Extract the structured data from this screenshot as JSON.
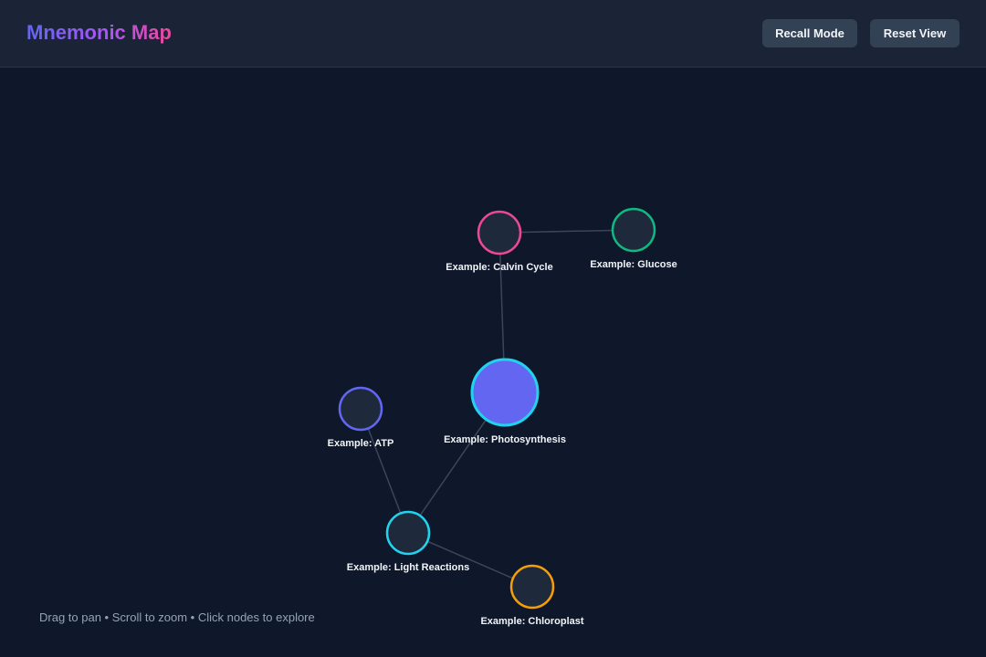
{
  "header": {
    "title": "Mnemonic Map",
    "buttons": {
      "recall_label": "Recall Mode",
      "reset_label": "Reset View"
    }
  },
  "graph": {
    "nodes": [
      {
        "id": "photosynthesis",
        "label": "Example: Photosynthesis",
        "stroke": "#22d3ee",
        "fill": "#6366f1",
        "central": true
      },
      {
        "id": "calvin-cycle",
        "label": "Example: Calvin Cycle",
        "stroke": "#ec4899",
        "fill": "#1e293b"
      },
      {
        "id": "glucose",
        "label": "Example: Glucose",
        "stroke": "#10b981",
        "fill": "#1e293b"
      },
      {
        "id": "atp",
        "label": "Example: ATP",
        "stroke": "#6366f1",
        "fill": "#1e293b"
      },
      {
        "id": "light-reactions",
        "label": "Example: Light Reactions",
        "stroke": "#22d3ee",
        "fill": "#1e293b"
      },
      {
        "id": "chloroplast",
        "label": "Example: Chloroplast",
        "stroke": "#f59e0b",
        "fill": "#1e293b"
      }
    ],
    "edges": [
      {
        "from": "calvin-cycle",
        "to": "glucose"
      },
      {
        "from": "calvin-cycle",
        "to": "photosynthesis"
      },
      {
        "from": "photosynthesis",
        "to": "light-reactions"
      },
      {
        "from": "atp",
        "to": "light-reactions"
      },
      {
        "from": "light-reactions",
        "to": "chloroplast"
      }
    ],
    "edge_color": "#3b4658"
  },
  "footer": {
    "hint": "Drag to pan • Scroll to zoom • Click nodes to explore"
  }
}
